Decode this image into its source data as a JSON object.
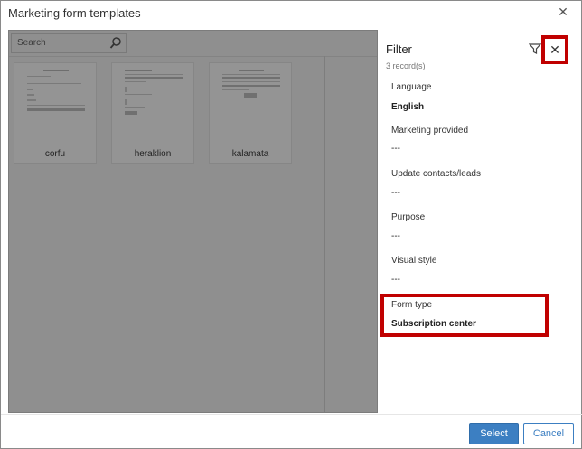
{
  "window": {
    "title": "Marketing form templates"
  },
  "search": {
    "placeholder": "Search"
  },
  "templates": [
    {
      "name": "corfu"
    },
    {
      "name": "heraklion"
    },
    {
      "name": "kalamata"
    }
  ],
  "filter": {
    "title": "Filter",
    "count": "3 record(s)",
    "fields": [
      {
        "label": "Language",
        "value": "English"
      },
      {
        "label": "Marketing provided",
        "value": "---"
      },
      {
        "label": "Update contacts/leads",
        "value": "---"
      },
      {
        "label": "Purpose",
        "value": "---"
      },
      {
        "label": "Visual style",
        "value": "---"
      },
      {
        "label": "Form type",
        "value": "Subscription center"
      }
    ]
  },
  "footer": {
    "select_label": "Select",
    "cancel_label": "Cancel"
  },
  "colors": {
    "highlight": "#c00000",
    "primary": "#3c7fc2",
    "overlay": "#8f8f8f"
  }
}
